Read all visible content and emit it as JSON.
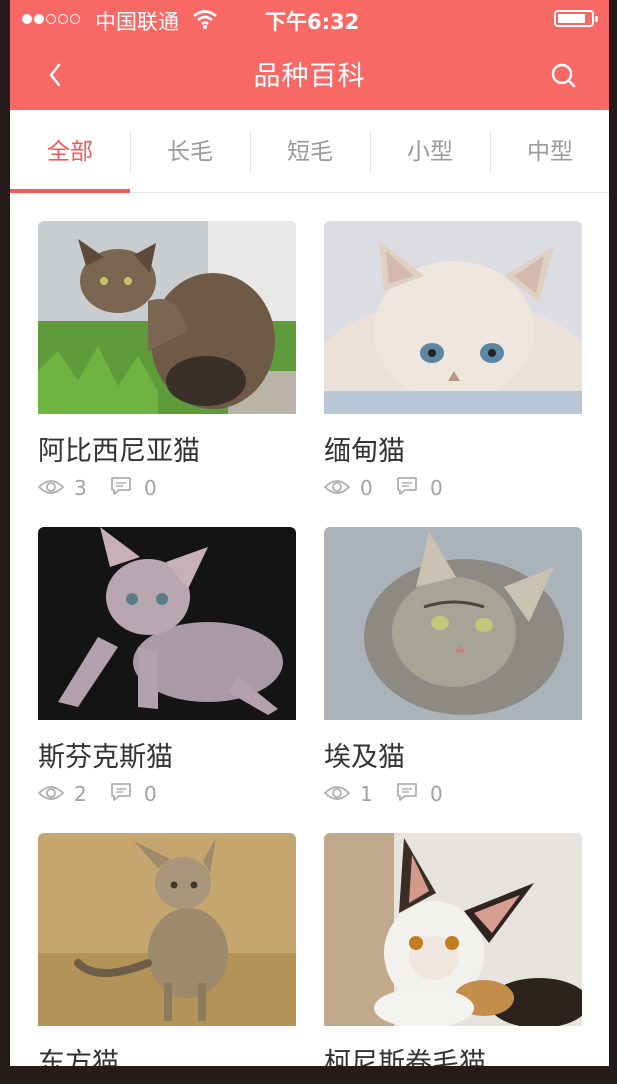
{
  "status_bar": {
    "carrier": "中国联通",
    "time": "下午6:32"
  },
  "nav": {
    "title": "品种百科",
    "back_icon": "chevron-left-icon",
    "search_icon": "search-icon"
  },
  "tabs": [
    {
      "label": "全部",
      "active": true
    },
    {
      "label": "长毛",
      "active": false
    },
    {
      "label": "短毛",
      "active": false
    },
    {
      "label": "小型",
      "active": false
    },
    {
      "label": "中型",
      "active": false
    }
  ],
  "colors": {
    "brand": "#f86865",
    "tab_active": "#f45a55"
  },
  "breeds": [
    {
      "name": "阿比西尼亚猫",
      "views": "3",
      "comments": "0"
    },
    {
      "name": "缅甸猫",
      "views": "0",
      "comments": "0"
    },
    {
      "name": "斯芬克斯猫",
      "views": "2",
      "comments": "0"
    },
    {
      "name": "埃及猫",
      "views": "1",
      "comments": "0"
    },
    {
      "name": "东方猫",
      "views": "",
      "comments": ""
    },
    {
      "name": "柯尼斯卷毛猫",
      "views": "",
      "comments": ""
    }
  ]
}
